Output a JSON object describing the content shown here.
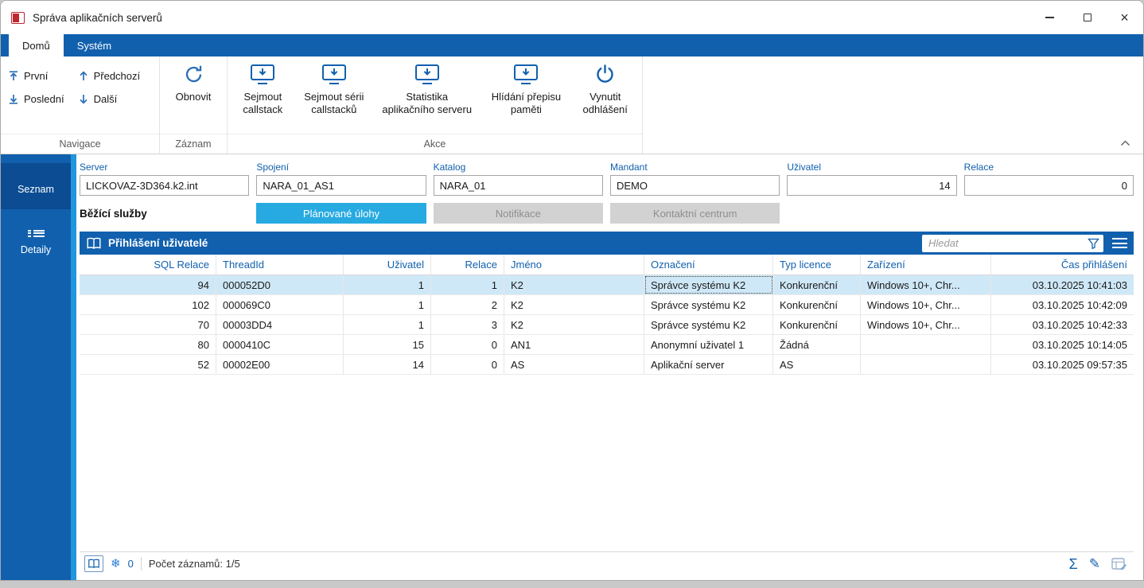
{
  "window": {
    "title": "Správa aplikačních serverů"
  },
  "ribbon": {
    "tabs": [
      {
        "label": "Domů"
      },
      {
        "label": "Systém"
      }
    ],
    "nav_items": [
      {
        "label": "První"
      },
      {
        "label": "Předchozí"
      },
      {
        "label": "Poslední"
      },
      {
        "label": "Další"
      }
    ],
    "refresh_label": "Obnovit",
    "actions": [
      {
        "label": "Sejmout callstack"
      },
      {
        "label": "Sejmout sérii callstacků"
      },
      {
        "label": "Statistika aplikačního serveru"
      },
      {
        "label": "Hlídání přepisu paměti"
      },
      {
        "label": "Vynutit odhlášení"
      }
    ],
    "group_labels": {
      "navigation": "Navigace",
      "record": "Záznam",
      "action": "Akce"
    }
  },
  "sidebar": {
    "items": [
      {
        "label": "Seznam"
      },
      {
        "label": "Detaily"
      }
    ]
  },
  "form": {
    "fields": [
      {
        "label": "Server",
        "value": "LICKOVAZ-3D364.k2.int"
      },
      {
        "label": "Spojení",
        "value": "NARA_01_AS1"
      },
      {
        "label": "Katalog",
        "value": "NARA_01"
      },
      {
        "label": "Mandant",
        "value": "DEMO"
      },
      {
        "label": "Uživatel",
        "value": "14"
      },
      {
        "label": "Relace",
        "value": "0"
      }
    ]
  },
  "services": {
    "label": "Běžící služby",
    "buttons": [
      {
        "label": "Plánované úlohy",
        "state": "active"
      },
      {
        "label": "Notifikace",
        "state": "disabled"
      },
      {
        "label": "Kontaktní centrum",
        "state": "disabled"
      }
    ]
  },
  "table": {
    "title": "Přihlášení uživatelé",
    "search_placeholder": "Hledat",
    "columns": [
      "SQL Relace",
      "ThreadId",
      "Uživatel",
      "Relace",
      "Jméno",
      "Označení",
      "Typ licence",
      "Zařízení",
      "Čas přihlášení"
    ],
    "rows": [
      [
        "94",
        "000052D0",
        "1",
        "1",
        "K2",
        "Správce systému K2",
        "Konkurenční",
        "Windows 10+, Chr...",
        "03.10.2025 10:41:03"
      ],
      [
        "102",
        "000069C0",
        "1",
        "2",
        "K2",
        "Správce systému K2",
        "Konkurenční",
        "Windows 10+, Chr...",
        "03.10.2025 10:42:09"
      ],
      [
        "70",
        "00003DD4",
        "1",
        "3",
        "K2",
        "Správce systému K2",
        "Konkurenční",
        "Windows 10+, Chr...",
        "03.10.2025 10:42:33"
      ],
      [
        "80",
        "0000410C",
        "15",
        "0",
        "AN1",
        "Anonymní uživatel 1",
        "Žádná",
        "",
        "03.10.2025 10:14:05"
      ],
      [
        "52",
        "00002E00",
        "14",
        "0",
        "AS",
        "Aplikační server",
        "AS",
        "",
        "03.10.2025 09:57:35"
      ]
    ],
    "status": {
      "pinned_count": "0",
      "record_count": "Počet záznamů: 1/5"
    }
  },
  "icons": {
    "snowflake": "❄",
    "sigma": "Σ",
    "pencil": "✎",
    "close": "×"
  },
  "colors": {
    "brand_blue": "#1160ae",
    "accent_cyan": "#27aae1",
    "selected_row": "#cfe8f7"
  }
}
